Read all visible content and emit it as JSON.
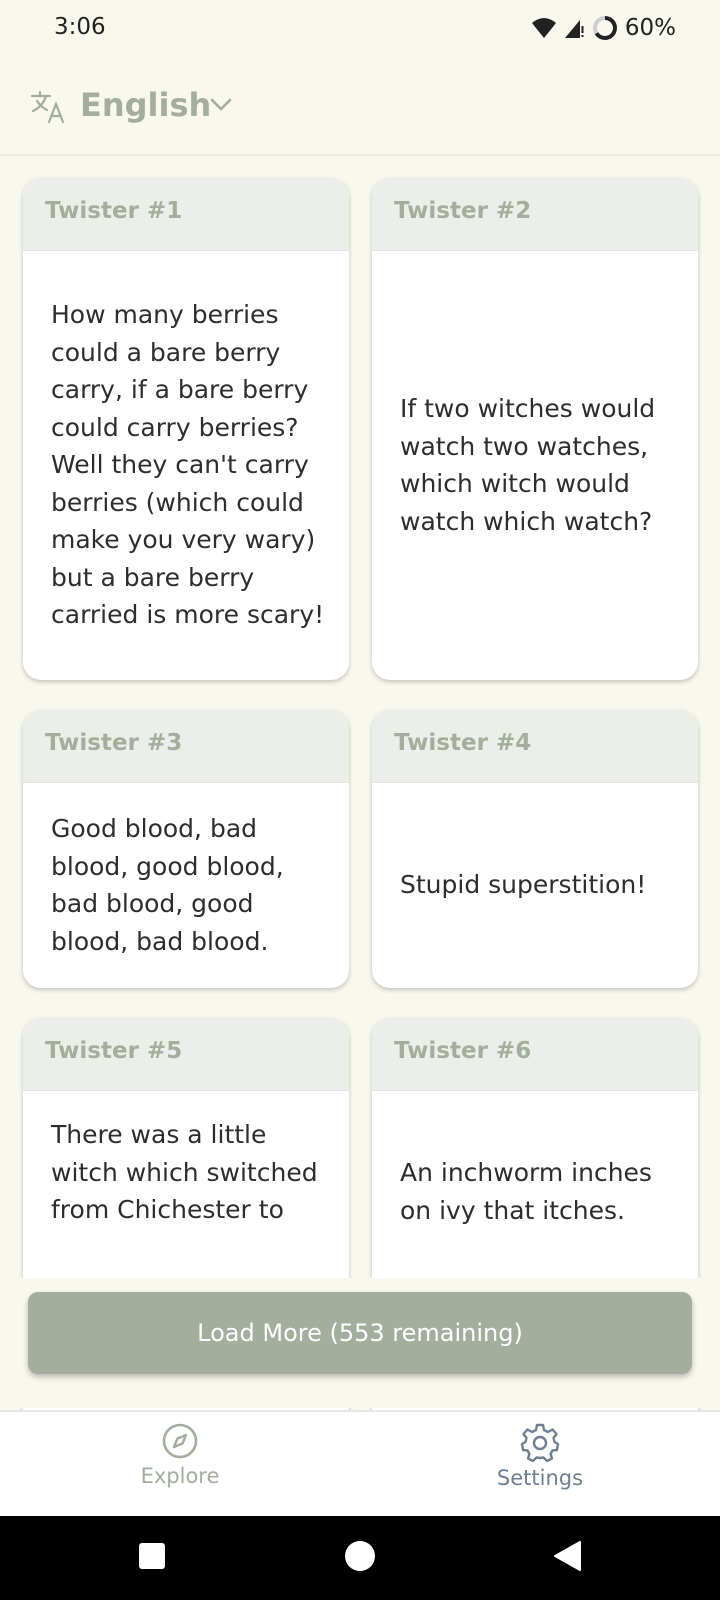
{
  "status_bar": {
    "time": "3:06",
    "battery": "60%"
  },
  "language": {
    "label": "English"
  },
  "cards": [
    {
      "title": "Twister #1",
      "text": "How many berries could a bare berry carry, if a bare berry could carry berries? Well they can't carry berries (which could make you very wary) but a bare berry carried is more scary!"
    },
    {
      "title": "Twister #2",
      "text": "If two witches would watch two watches, which witch would watch which watch?"
    },
    {
      "title": "Twister #3",
      "text": "Good blood, bad blood, good blood, bad blood, good blood, bad blood."
    },
    {
      "title": "Twister #4",
      "text": "Stupid superstition!"
    },
    {
      "title": "Twister #5",
      "text": "There was a little witch which switched from Chichester to"
    },
    {
      "title": "Twister #6",
      "text": "An inchworm inches on ivy that itches."
    }
  ],
  "load_more": {
    "label": "Load More (553 remaining)"
  },
  "bottom_nav": {
    "explore": "Explore",
    "settings": "Settings"
  },
  "colors": {
    "accent": "#a3ae9c",
    "background": "#f8f8ee",
    "card_header": "#eceee9",
    "settings_label": "#6e7f8f"
  },
  "icons": {
    "language": "translate-icon",
    "chevron": "chevron-down-icon",
    "explore": "compass-icon",
    "settings": "gear-icon"
  }
}
